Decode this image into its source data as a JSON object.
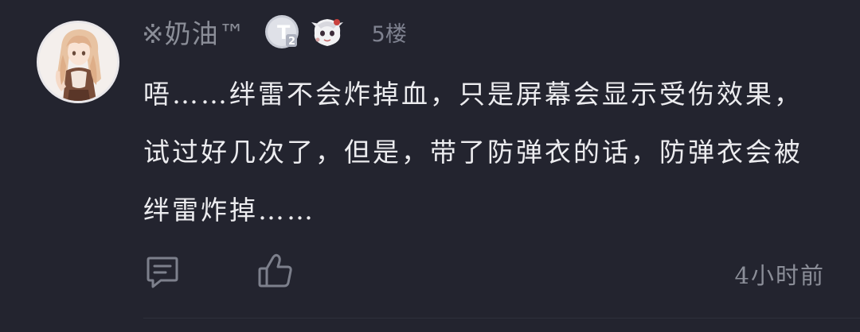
{
  "comment": {
    "username": "※奶油™",
    "floor": "5楼",
    "content": "唔……绊雷不会炸掉血，只是屏幕会显示受伤效果，试过好几次了，但是，带了防弹衣的话，防弹衣会被绊雷炸掉……",
    "timestamp": "4小时前",
    "badge_level_text": "T",
    "badge_level_sub": "2"
  },
  "colors": {
    "background": "#23242f",
    "text_primary": "#ececef",
    "text_secondary": "#8b8e98"
  },
  "icons": {
    "reply": "comment-bubble-icon",
    "like": "thumbs-up-icon"
  }
}
